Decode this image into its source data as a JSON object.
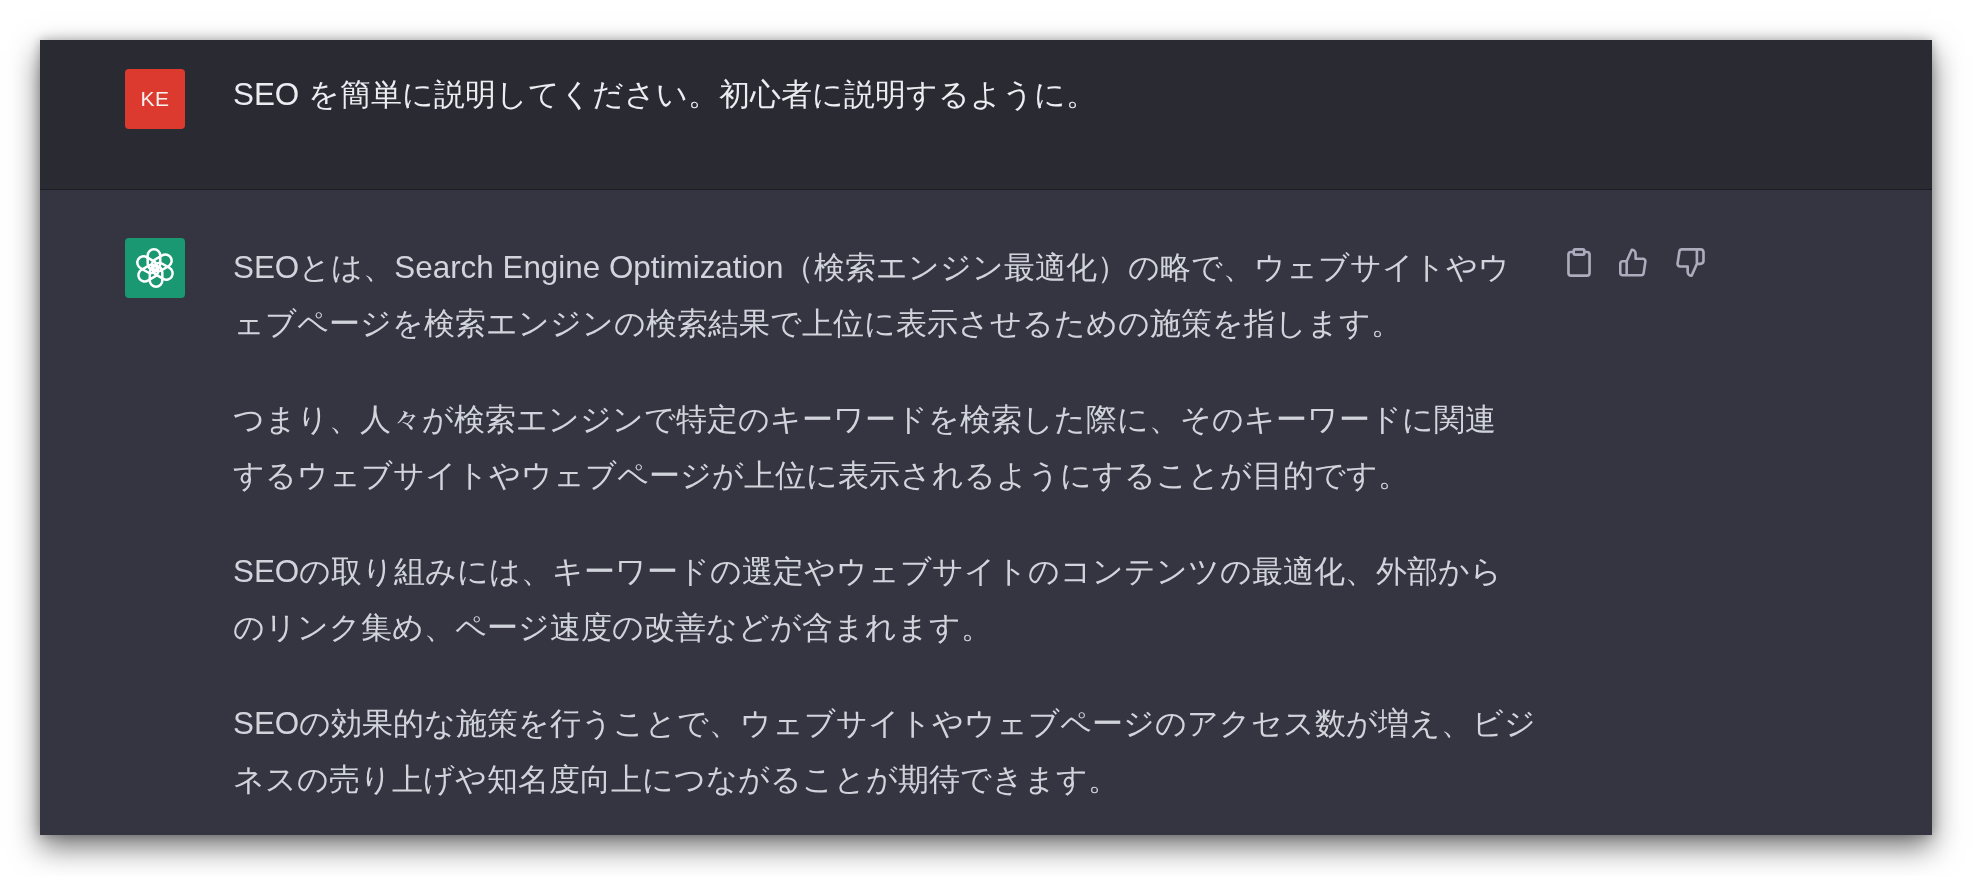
{
  "messages": [
    {
      "kind": "user",
      "avatar": {
        "initials": "KE",
        "color": "#dc3a2f"
      },
      "paragraphs": [
        {
          "lines": [
            "SEO を簡単に説明してください。初心者に説明するように。"
          ]
        }
      ]
    },
    {
      "kind": "assistant",
      "avatar": {
        "color": "#1a9872"
      },
      "paragraphs": [
        {
          "lines": [
            "SEOとは、Search Engine Optimization（検索エンジン最適化）の略で、ウェブサイトやウ",
            "ェブページを検索エンジンの検索結果で上位に表示させるための施策を指します。"
          ]
        },
        {
          "lines": [
            "つまり、人々が検索エンジンで特定のキーワードを検索した際に、そのキーワードに関連",
            "するウェブサイトやウェブページが上位に表示されるようにすることが目的です。"
          ]
        },
        {
          "lines": [
            "SEOの取り組みには、キーワードの選定やウェブサイトのコンテンツの最適化、外部から",
            "のリンク集め、ページ速度の改善などが含まれます。"
          ]
        },
        {
          "lines": [
            "SEOの効果的な施策を行うことで、ウェブサイトやウェブページのアクセス数が増え、ビジ",
            "ネスの売り上げや知名度向上につながることが期待できます。"
          ]
        }
      ],
      "actions": [
        {
          "kind": "copy"
        },
        {
          "kind": "like"
        },
        {
          "kind": "dislike"
        }
      ]
    }
  ]
}
